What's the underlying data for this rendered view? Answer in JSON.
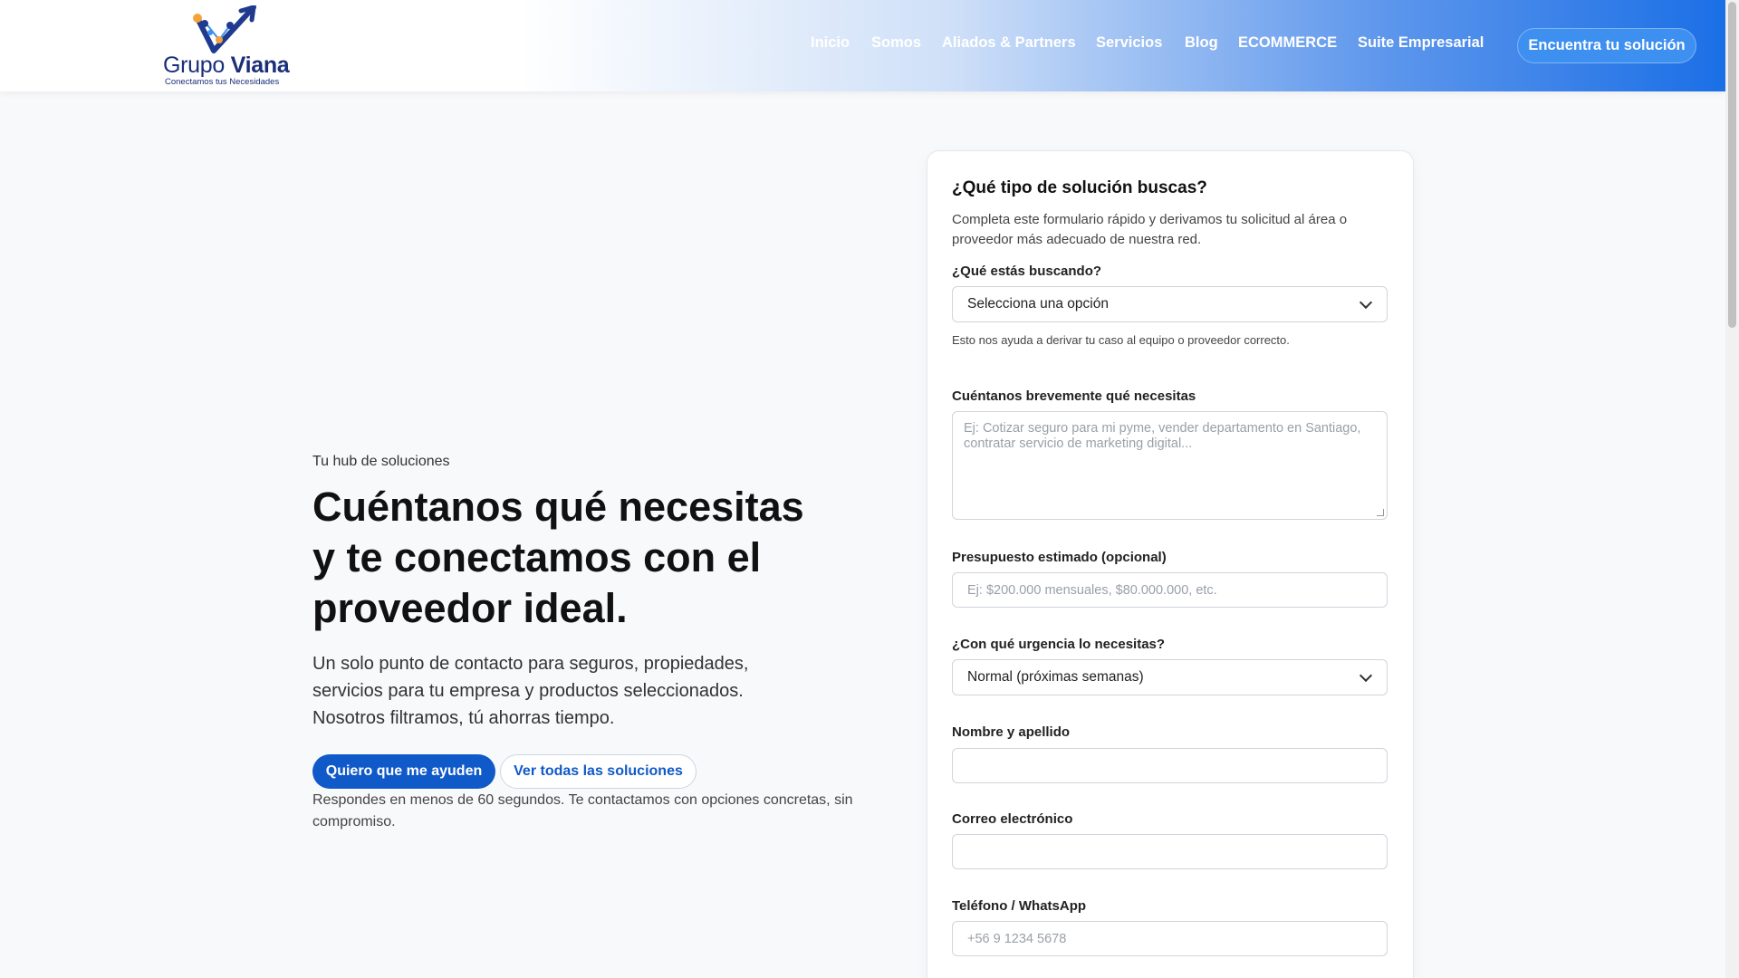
{
  "brand": {
    "name_light": "Grupo ",
    "name_bold": "Viana",
    "tagline": "Conectamos tus Necesidades"
  },
  "nav": {
    "items": [
      "Inicio",
      "Somos",
      "Aliados & Partners",
      "Servicios",
      "Blog",
      "ECOMMERCE",
      "Suite Empresarial"
    ],
    "cta": "Encuentra tu solución"
  },
  "hero": {
    "eyebrow": "Tu hub de soluciones",
    "title_lines": [
      "Cuéntanos qué necesitas",
      "y te conectamos con el",
      "proveedor ideal."
    ],
    "subtitle_lines": [
      "Un solo punto de contacto para seguros, propiedades,",
      "servicios para tu empresa y productos seleccionados.",
      "Nosotros filtramos, tú ahorras tiempo."
    ],
    "primary_button": "Quiero que me ayuden",
    "secondary_button": "Ver todas las soluciones",
    "note": "Respondes en menos de 60 segundos. Te contactamos con opciones concretas, sin compromiso."
  },
  "form": {
    "title": "¿Qué tipo de solución buscas?",
    "description": "Completa este formulario rápido y derivamos tu solicitud al área o proveedor más adecuado de nuestra red.",
    "looking_for": {
      "label": "¿Qué estás buscando?",
      "value": "Selecciona una opción",
      "help": "Esto nos ayuda a derivar tu caso al equipo o proveedor correcto."
    },
    "need": {
      "label": "Cuéntanos brevemente qué necesitas",
      "placeholder": "Ej: Cotizar seguro para mi pyme, vender departamento en Santiago, contratar servicio de marketing digital..."
    },
    "budget": {
      "label": "Presupuesto estimado (opcional)",
      "placeholder": "Ej: $200.000 mensuales, $80.000.000, etc."
    },
    "urgency": {
      "label": "¿Con qué urgencia lo necesitas?",
      "value": "Normal (próximas semanas)"
    },
    "name": {
      "label": "Nombre y apellido",
      "value": ""
    },
    "email": {
      "label": "Correo electrónico",
      "value": ""
    },
    "phone": {
      "label": "Teléfono / WhatsApp",
      "placeholder": "+56 9 1234 5678"
    }
  },
  "colors": {
    "primary": "#1059c9",
    "cta": "#3d8ff0",
    "header_gradient_end": "#1b6fe6"
  },
  "icons": {
    "logo": "v-checkmark-network-logo",
    "select_arrow": "chevron-down-icon"
  }
}
